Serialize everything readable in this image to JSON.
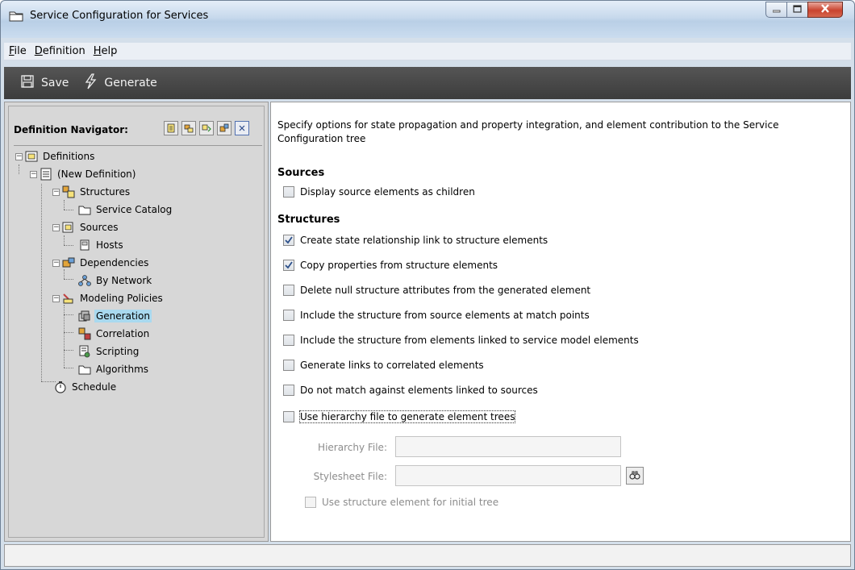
{
  "window": {
    "title": "Service Configuration for Services",
    "controls": {
      "minimize": "minimize-icon",
      "maximize": "maximize-icon",
      "close": "close-icon"
    }
  },
  "menu": {
    "items": [
      {
        "label": "File",
        "mnemonic": "F",
        "rest": "ile"
      },
      {
        "label": "Definition",
        "mnemonic": "D",
        "rest": "efinition"
      },
      {
        "label": "Help",
        "mnemonic": "H",
        "rest": "elp"
      }
    ]
  },
  "toolbar": {
    "save_label": "Save",
    "generate_label": "Generate"
  },
  "navigator": {
    "title": "Definition Navigator:",
    "tools": [
      "new-definition-icon",
      "structures-tool-icon",
      "sources-tool-icon",
      "dependencies-tool-icon",
      "close-navigator-icon"
    ],
    "tree": {
      "definitions": "Definitions",
      "new_definition": "(New Definition)",
      "structures": "Structures",
      "service_catalog": "Service Catalog",
      "sources": "Sources",
      "hosts": "Hosts",
      "dependencies": "Dependencies",
      "by_network": "By Network",
      "modeling_policies": "Modeling Policies",
      "generation": "Generation",
      "correlation": "Correlation",
      "scripting": "Scripting",
      "algorithms": "Algorithms",
      "schedule": "Schedule"
    },
    "selected": "Generation"
  },
  "main": {
    "description": "Specify options for state propagation and property integration, and element contribution to the Service Configuration tree",
    "sources_heading": "Sources",
    "sources_options": [
      {
        "label": "Display source elements as children",
        "checked": false
      }
    ],
    "structures_heading": "Structures",
    "structures_options": [
      {
        "label": "Create state relationship link to structure elements",
        "checked": true
      },
      {
        "label": "Copy properties from structure elements",
        "checked": true
      },
      {
        "label": "Delete null structure attributes from the generated element",
        "checked": false
      },
      {
        "label": "Include the structure from source elements at match points",
        "checked": false
      },
      {
        "label": "Include the structure from elements linked to service model elements",
        "checked": false
      },
      {
        "label": "Generate links to correlated elements",
        "checked": false
      },
      {
        "label": "Do not match against elements linked to sources",
        "checked": false
      },
      {
        "label": "Use hierarchy file to generate element trees",
        "checked": false
      }
    ],
    "hierarchy_file_label": "Hierarchy File:",
    "hierarchy_file_value": "",
    "stylesheet_file_label": "Stylesheet File:",
    "stylesheet_file_value": "",
    "initial_tree_label": "Use structure element for initial tree",
    "initial_tree_checked": false
  },
  "status": {
    "text": ""
  }
}
